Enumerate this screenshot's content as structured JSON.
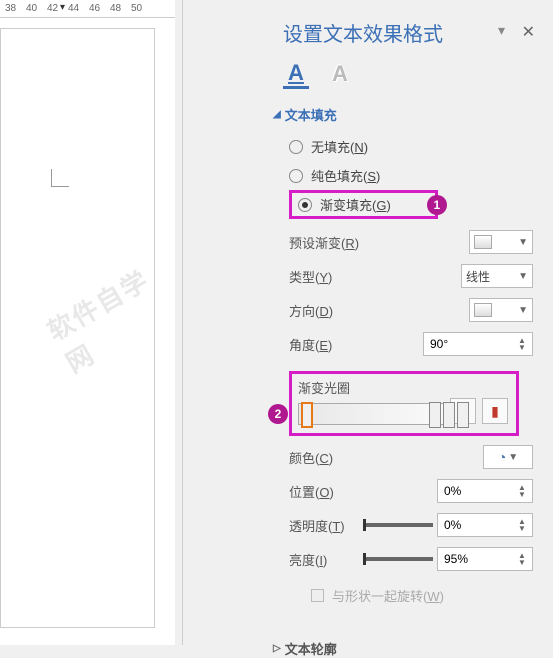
{
  "ruler": {
    "ticks": [
      "38",
      "40",
      "42",
      "44",
      "46",
      "48",
      "50"
    ]
  },
  "watermark": "软件自学网",
  "panel": {
    "title": "设置文本效果格式",
    "tabs": {
      "a1": "A",
      "a2": "A"
    },
    "fill": {
      "header": "文本填充",
      "options": {
        "none": "无填充(N)",
        "solid": "纯色填充(S)",
        "gradient": "渐变填充(G)"
      },
      "preset": {
        "label": "预设渐变(R)"
      },
      "type": {
        "label": "类型(Y)",
        "value": "线性"
      },
      "direction": {
        "label": "方向(D)"
      },
      "angle": {
        "label": "角度(E)",
        "value": "90°"
      },
      "stops_label": "渐变光圈",
      "color": {
        "label": "颜色(C)"
      },
      "position": {
        "label": "位置(O)",
        "value": "0%"
      },
      "transparency": {
        "label": "透明度(T)",
        "value": "0%"
      },
      "brightness": {
        "label": "亮度(I)",
        "value": "95%"
      },
      "rotate_with_shape": "与形状一起旋转(W)"
    },
    "outline": {
      "header": "文本轮廓"
    },
    "callouts": {
      "c1": "1",
      "c2": "2"
    }
  }
}
